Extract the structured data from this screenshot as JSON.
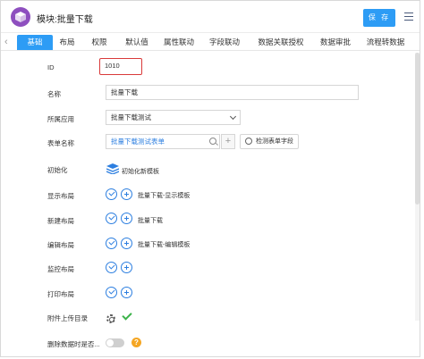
{
  "header": {
    "title": "模块:批量下载",
    "save_label": "保 存",
    "logo_icon": "cube-icon",
    "menu_icon": "menu-icon",
    "accent_color": "#2d9cf5",
    "logo_color": "#8e4fbf"
  },
  "tabs": [
    {
      "label": "基础",
      "active": true
    },
    {
      "label": "布局",
      "active": false
    },
    {
      "label": "权限",
      "active": false
    },
    {
      "label": "默认值",
      "active": false
    },
    {
      "label": "属性联动",
      "active": false
    },
    {
      "label": "字段联动",
      "active": false
    },
    {
      "label": "数据关联授权",
      "active": false
    },
    {
      "label": "数据审批",
      "active": false
    },
    {
      "label": "流程转数据",
      "active": false
    }
  ],
  "form": {
    "id": {
      "label": "ID",
      "value": "1010"
    },
    "name": {
      "label": "名称",
      "value": "批量下载"
    },
    "app": {
      "label": "所属应用",
      "value": "批量下载测试"
    },
    "table": {
      "label": "表单名称",
      "value": "批量下载测试表单",
      "detect_label": "检测表单字段"
    },
    "init": {
      "label": "初始化",
      "value": "初始化新模板"
    },
    "display_layout": {
      "label": "显示布局",
      "value": "批量下载-显示模板"
    },
    "new_layout": {
      "label": "新建布局",
      "value": "批量下载"
    },
    "edit_layout": {
      "label": "编辑布局",
      "value": "批量下载-编辑模板"
    },
    "monitor_layout": {
      "label": "监控布局",
      "value": ""
    },
    "print_layout": {
      "label": "打印布局",
      "value": ""
    },
    "attachment_dir": {
      "label": "附件上传目录"
    },
    "delete_data": {
      "label": "删除数据时是否...",
      "toggle_on": false
    }
  },
  "scroll": {
    "position": 0
  }
}
